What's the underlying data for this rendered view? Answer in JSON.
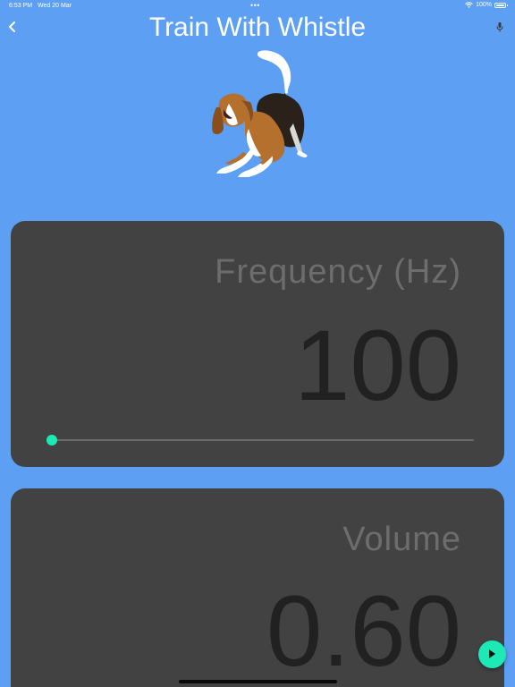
{
  "status_bar": {
    "time": "6:53 PM",
    "date": "Wed 20 Mar",
    "battery": "100%",
    "icons": [
      "wifi-icon",
      "battery-icon"
    ]
  },
  "nav": {
    "title": "Train With Whistle",
    "back_icon": "chevron-left-icon",
    "right_icon": "microphone-icon"
  },
  "illustration": {
    "subject": "dog-icon"
  },
  "frequency": {
    "label": "Frequency (Hz)",
    "value": "100",
    "slider_fraction": 0.0
  },
  "volume": {
    "label": "Volume",
    "value": "0.60"
  },
  "play_button": {
    "icon": "play-icon"
  },
  "colors": {
    "background": "#5c9ff3",
    "card": "#424242",
    "accent": "#1de9b6",
    "label_text": "#6d6d6d",
    "value_text": "#212121"
  }
}
